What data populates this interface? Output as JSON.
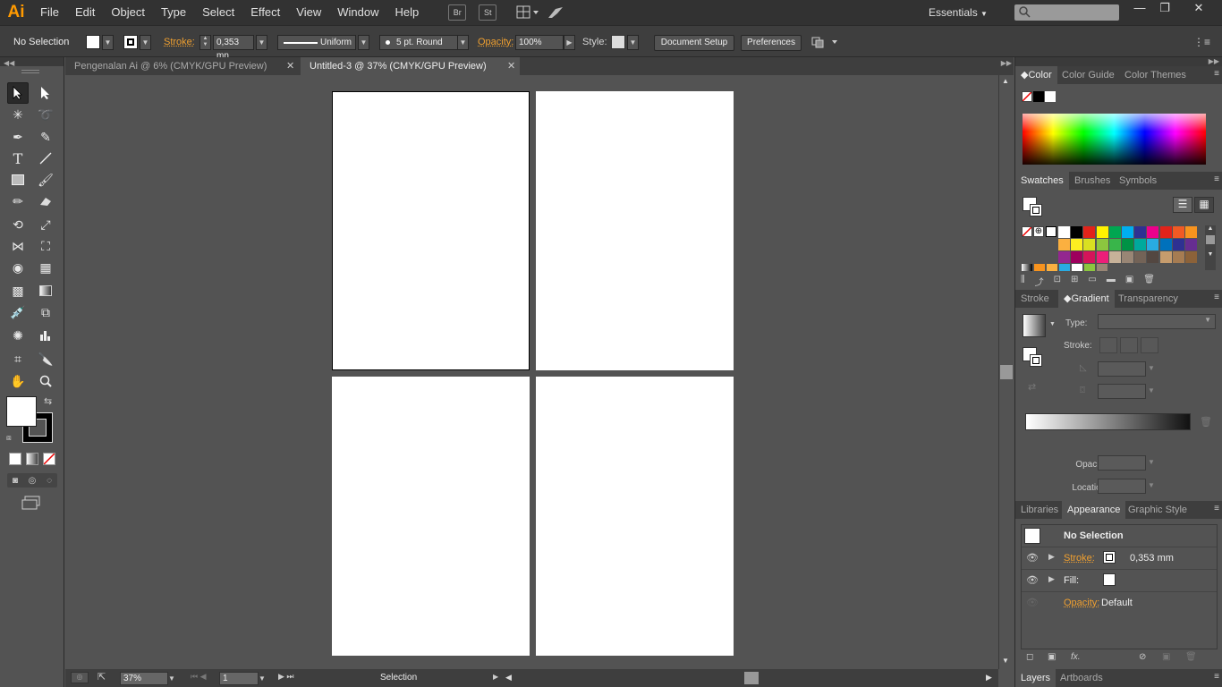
{
  "app": {
    "logo": "Ai",
    "menu": [
      "File",
      "Edit",
      "Object",
      "Type",
      "Select",
      "Effect",
      "View",
      "Window",
      "Help"
    ],
    "bridge_btn": "Br",
    "stock_btn": "St",
    "workspace": "Essentials",
    "window_controls": [
      "—",
      "❐",
      "✕"
    ]
  },
  "control_bar": {
    "selection_label": "No Selection",
    "stroke_label": "Stroke:",
    "stroke_value": "0,353 mn",
    "profile_value": "Uniform",
    "brush_value": "5 pt. Round",
    "opacity_label": "Opacity:",
    "opacity_value": "100%",
    "style_label": "Style:",
    "document_setup": "Document Setup",
    "preferences": "Preferences"
  },
  "tabs": [
    {
      "label": "Pengenalan Ai @ 6% (CMYK/GPU Preview)",
      "close": "✕"
    },
    {
      "label": "Untitled-3 @ 37% (CMYK/GPU Preview)",
      "close": "✕"
    }
  ],
  "status": {
    "zoom": "37%",
    "artboard": "1",
    "tool_name": "Selection"
  },
  "color_panel": {
    "tabs": [
      "Color",
      "Color Guide",
      "Color Themes"
    ]
  },
  "swatches_panel": {
    "tabs": [
      "Swatches",
      "Brushes",
      "Symbols"
    ],
    "rows": [
      [
        "#ffffff",
        "#000000",
        "#e2231a",
        "#fff200",
        "#00a651",
        "#00aeef",
        "#2e3192",
        "#ec008c",
        "#e2231a",
        "#f15a24",
        "#f7931e"
      ],
      [
        "#fbb040",
        "#fcee21",
        "#d9e021",
        "#8cc63f",
        "#39b54a",
        "#009245",
        "#00a99d",
        "#29abe2",
        "#0071bc",
        "#2e3192",
        "#662d91"
      ],
      [
        "#93278f",
        "#9e005d",
        "#d4145a",
        "#ed1e79",
        "#c7b299",
        "#998675",
        "#736357",
        "#534741",
        "#c69c6d",
        "#a67c52",
        "#8c6239"
      ]
    ]
  },
  "gradient_panel": {
    "tabs": [
      "Stroke",
      "Gradient",
      "Transparency"
    ],
    "type_label": "Type:",
    "stroke_label": "Stroke:",
    "opacity_label": "Opacity:",
    "location_label": "Location:"
  },
  "appearance_panel": {
    "tabs": [
      "Libraries",
      "Appearance",
      "Graphic Style"
    ],
    "title": "No Selection",
    "stroke_label": "Stroke:",
    "stroke_value": "0,353 mm",
    "fill_label": "Fill:",
    "opacity_label": "Opacity:",
    "opacity_value": "Default"
  },
  "layers_panel": {
    "tabs": [
      "Layers",
      "Artboards"
    ]
  }
}
